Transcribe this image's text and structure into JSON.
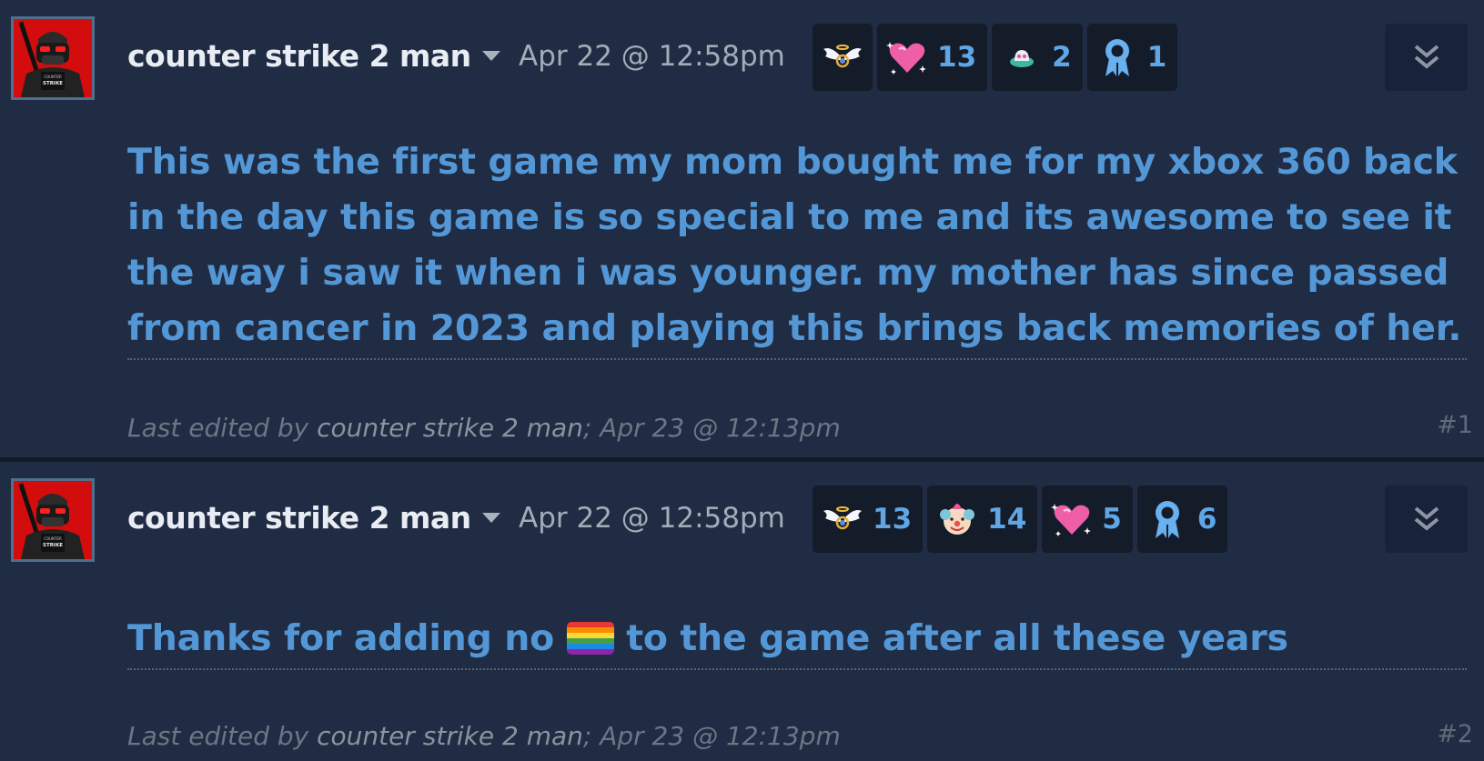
{
  "posts": [
    {
      "author": "counter strike 2 man",
      "timestamp": "Apr 22 @ 12:58pm",
      "awards": [
        {
          "icon": "angel-wings-award-icon",
          "count": ""
        },
        {
          "icon": "sparkling-heart-award-icon",
          "count": "13"
        },
        {
          "icon": "ufo-award-icon",
          "count": "2"
        },
        {
          "icon": "ribbon-award-icon",
          "count": "1"
        }
      ],
      "body": "This was the first game my mom bought me for my xbox 360 back in the day this game is so special to me and its awesome to see it the way i saw it when i was younger. my mother has since passed from cancer in 2023 and playing this brings back memories of her.",
      "edit_prefix": "Last edited by ",
      "edit_user": "counter strike 2 man",
      "edit_suffix": "; Apr 23 @ 12:13pm",
      "number": "#1"
    },
    {
      "author": "counter strike 2 man",
      "timestamp": "Apr 22 @ 12:58pm",
      "awards": [
        {
          "icon": "angel-wings-award-icon",
          "count": "13"
        },
        {
          "icon": "clown-face-award-icon",
          "count": "14"
        },
        {
          "icon": "sparkling-heart-award-icon",
          "count": "5"
        },
        {
          "icon": "ribbon-award-icon",
          "count": "6"
        }
      ],
      "body_before": "Thanks for adding no ",
      "body_emoji": "rainbow-flag-emoji",
      "body_after": " to the game after all these years",
      "edit_prefix": "Last edited by ",
      "edit_user": "counter strike 2 man",
      "edit_suffix": "; Apr 23 @ 12:13pm",
      "number": "#2"
    }
  ],
  "avatar_badge_text": [
    "COUNTER",
    "STRIKE"
  ],
  "colors": {
    "background": "#1f2c43",
    "body_text": "#5497d6",
    "award_count": "#60a6e4",
    "author": "#e9edf3",
    "avatar_bg": "#d30d0d"
  }
}
